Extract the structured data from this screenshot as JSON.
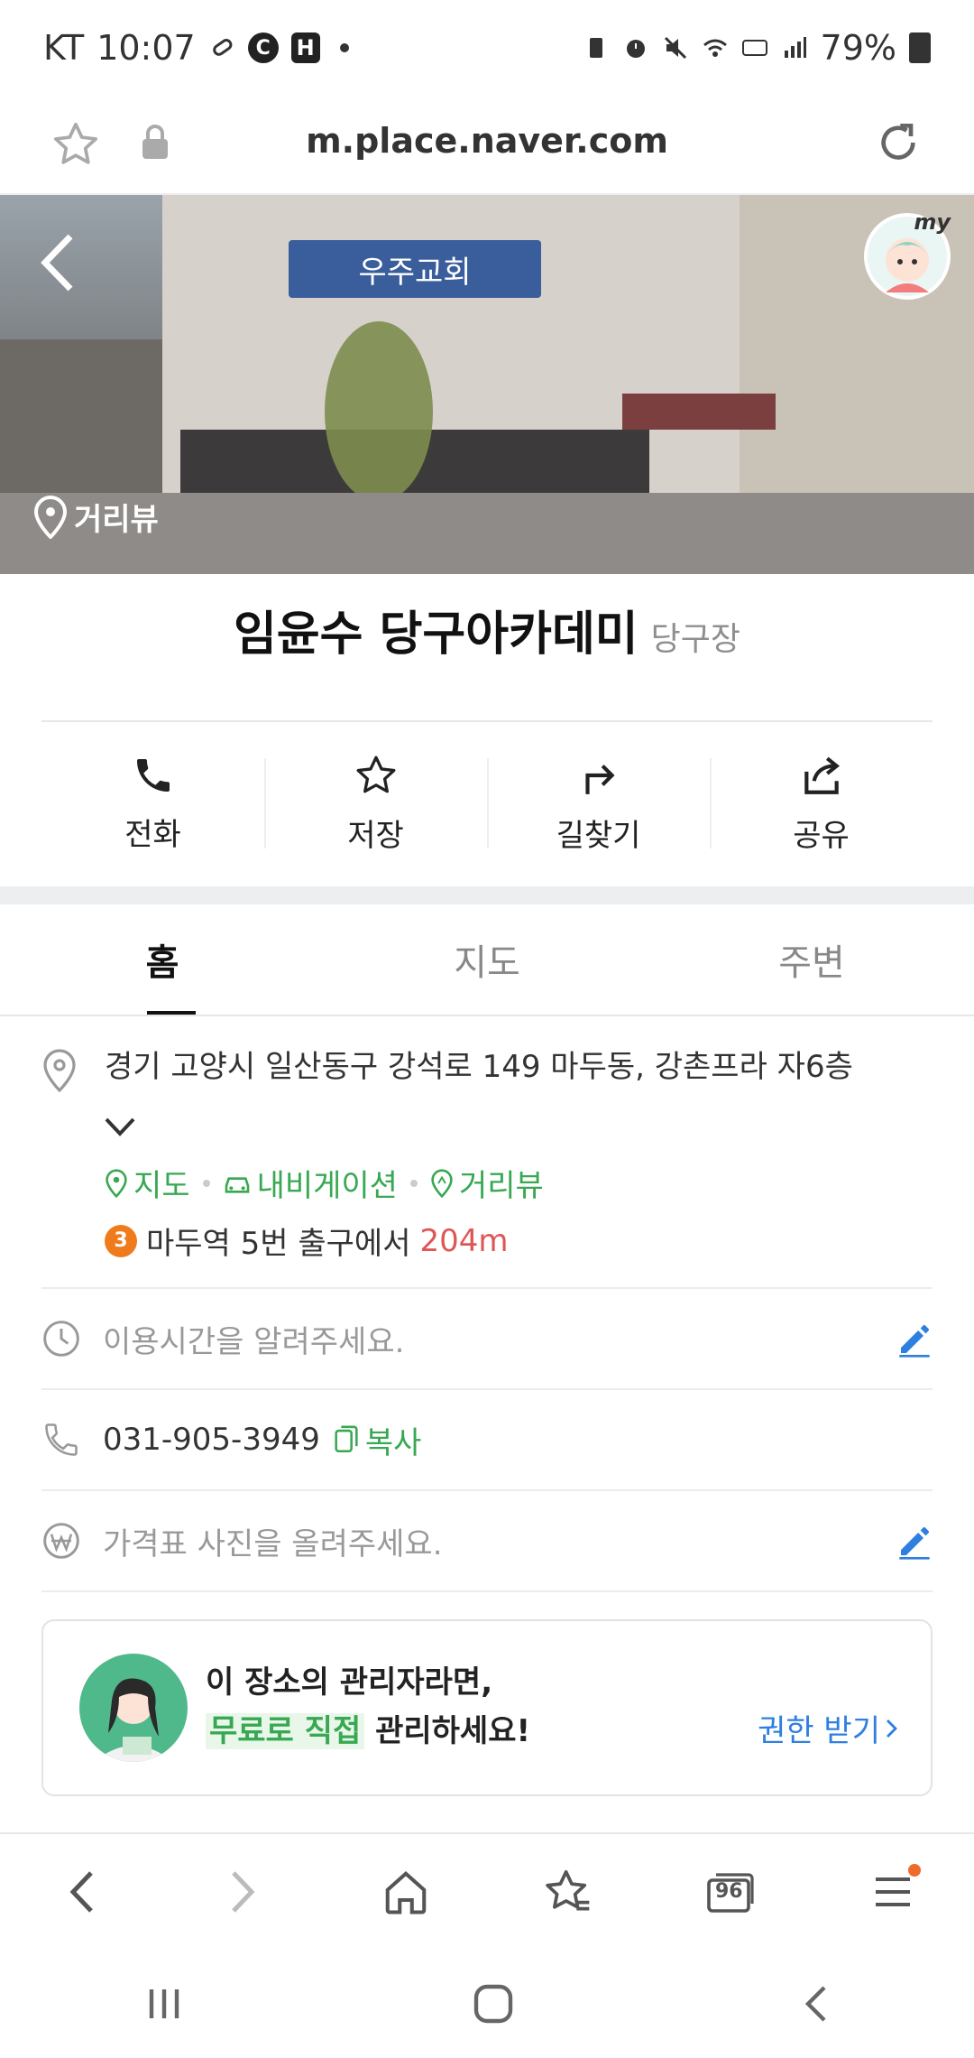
{
  "status_bar": {
    "carrier": "KT",
    "time": "10:07",
    "notif_c": "C",
    "notif_h": "H",
    "battery": "79%"
  },
  "browser": {
    "url": "m.place.naver.com"
  },
  "hero": {
    "sign_text": "우주교회",
    "avatar_badge": "my",
    "roadview_label": "거리뷰"
  },
  "place": {
    "name": "임윤수 당구아카데미",
    "category": "당구장"
  },
  "actions": [
    {
      "label": "전화",
      "icon": "phone-icon"
    },
    {
      "label": "저장",
      "icon": "star-icon"
    },
    {
      "label": "길찾기",
      "icon": "directions-icon"
    },
    {
      "label": "공유",
      "icon": "share-icon"
    }
  ],
  "tabs": [
    {
      "label": "홈",
      "active": true
    },
    {
      "label": "지도",
      "active": false
    },
    {
      "label": "주변",
      "active": false
    }
  ],
  "address": {
    "text": "경기 고양시 일산동구 강석로 149 마두동, 강촌프라 자6층",
    "links": [
      "지도",
      "내비게이션",
      "거리뷰"
    ],
    "subway_line": "3",
    "subway_text": "마두역 5번 출구에서",
    "subway_distance": "204m"
  },
  "hours": {
    "placeholder": "이용시간을 알려주세요."
  },
  "phone": {
    "number": "031-905-3949",
    "copy_label": "복사"
  },
  "price": {
    "placeholder": "가격표 사진을 올려주세요."
  },
  "owner_card": {
    "line1": "이 장소의 관리자라면,",
    "highlight": "무료로 직접",
    "line2_rest": " 관리하세요!",
    "cta": "권한 받기"
  },
  "bottom_bar": {
    "tabs_count": "96"
  },
  "colors": {
    "green": "#38a852",
    "blue": "#2d7fe0",
    "red": "#e05555",
    "line3_orange": "#ef7c1c"
  }
}
